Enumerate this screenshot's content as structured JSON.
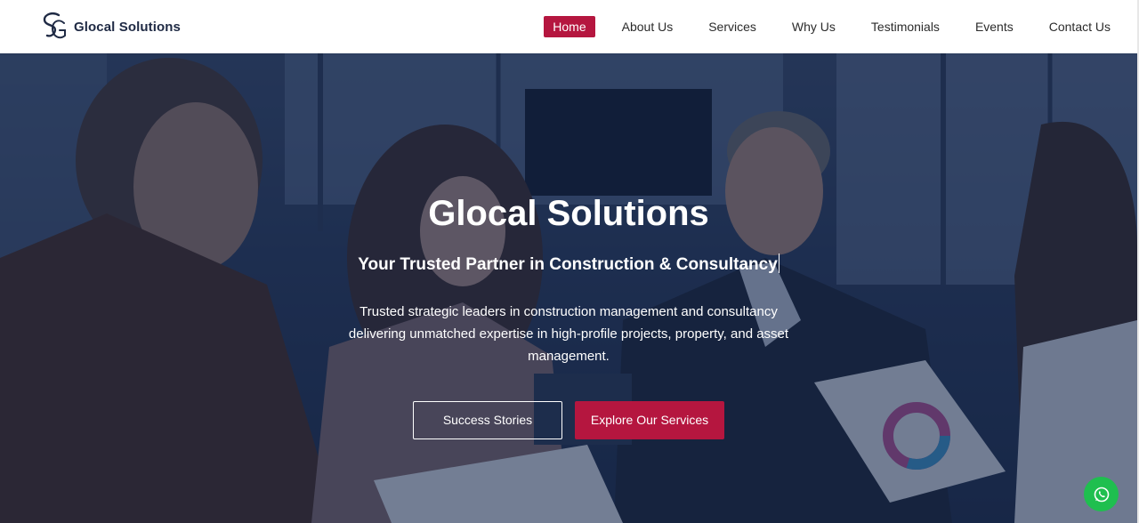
{
  "brand": {
    "name": "Glocal Solutions",
    "logo_icon": "gs-monogram-logo"
  },
  "nav": {
    "items": [
      {
        "label": "Home",
        "active": true
      },
      {
        "label": "About Us",
        "active": false
      },
      {
        "label": "Services",
        "active": false
      },
      {
        "label": "Why Us",
        "active": false
      },
      {
        "label": "Testimonials",
        "active": false
      },
      {
        "label": "Events",
        "active": false
      },
      {
        "label": "Contact Us",
        "active": false
      }
    ]
  },
  "hero": {
    "title": "Glocal Solutions",
    "subtitle": "Your Trusted Partner in Construction & Consultancy",
    "description": "Trusted strategic leaders in construction management and consultancy delivering unmatched expertise in high-profile projects, property, and asset management.",
    "buttons": {
      "secondary": "Success Stories",
      "primary": "Explore Our Services"
    },
    "background_image": "business-meeting-photo"
  },
  "floating": {
    "whatsapp_icon": "whatsapp-icon"
  },
  "colors": {
    "accent": "#b5163f",
    "nav_bg": "#ffffff",
    "overlay": "#122246",
    "whatsapp": "#1fbf4f"
  }
}
